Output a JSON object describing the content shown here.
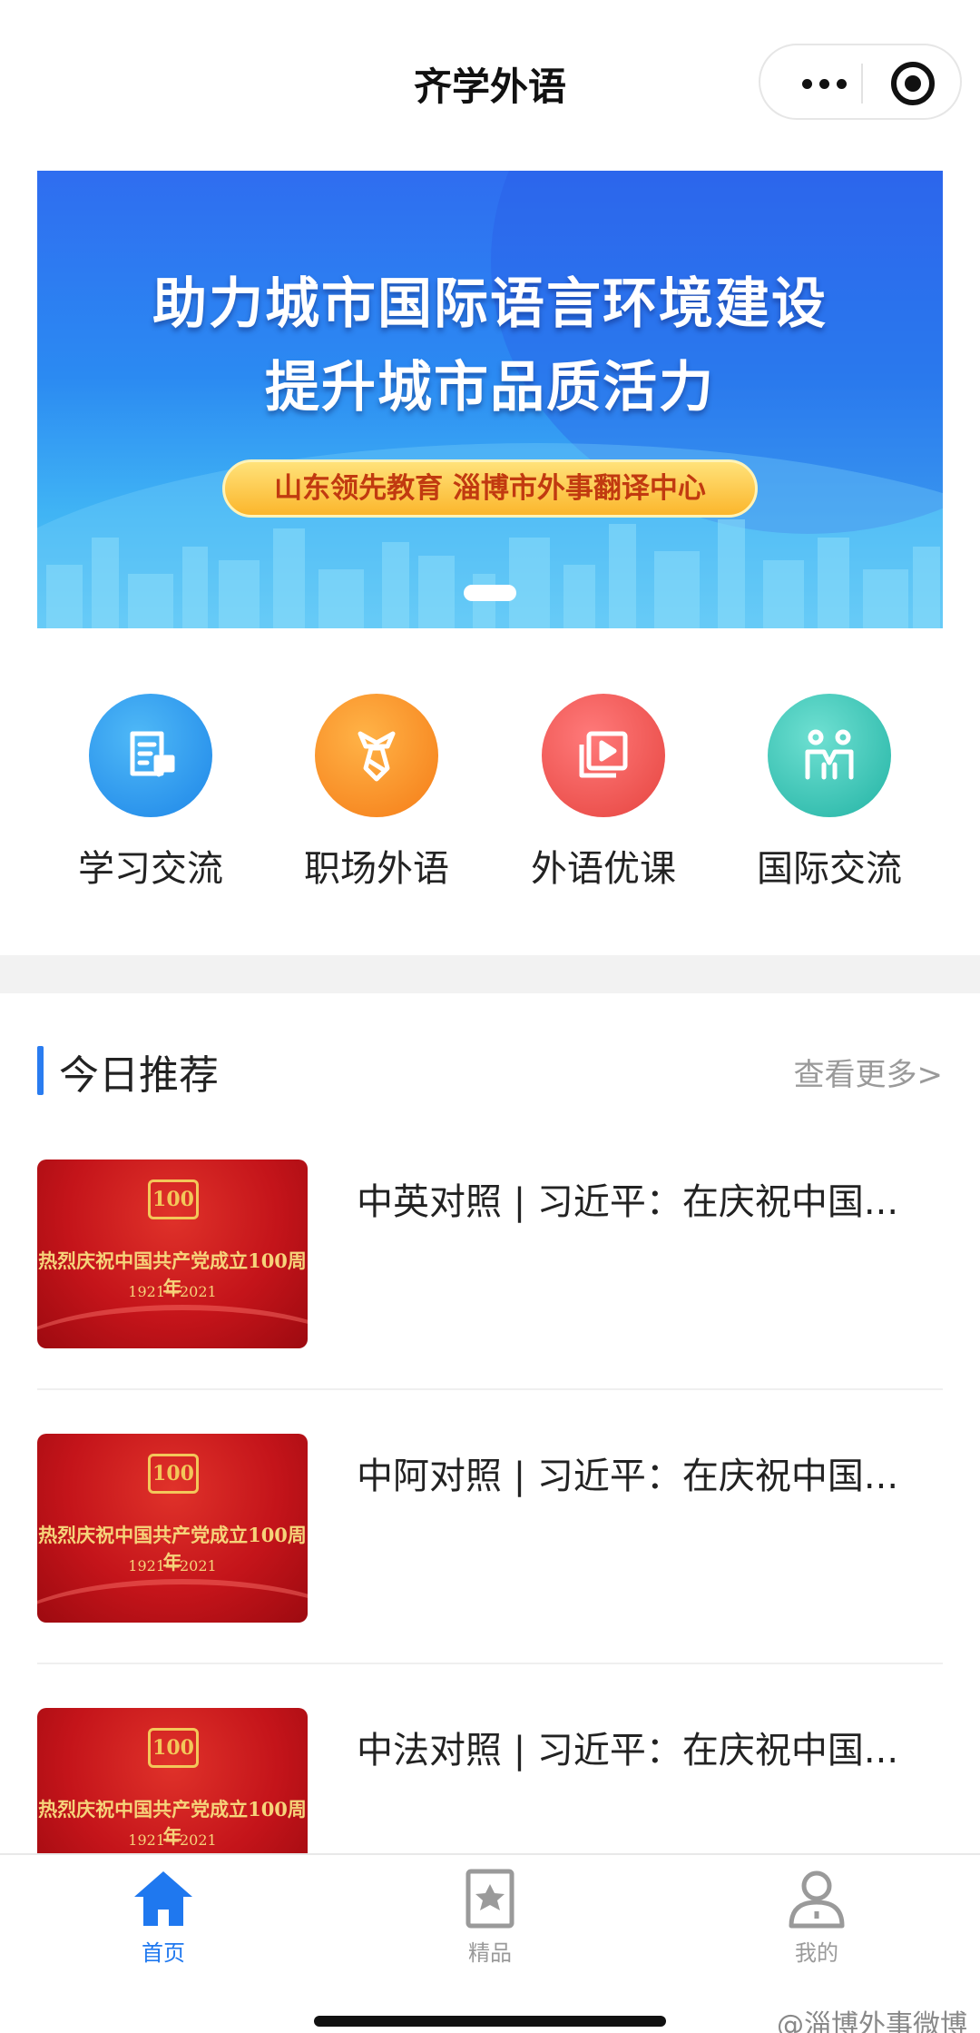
{
  "navbar": {
    "title": "齐学外语"
  },
  "banner": {
    "headline_1": "助力城市国际语言环境建设",
    "headline_2": "提升城市品质活力",
    "tagline": "山东领先教育  淄博市外事翻译中心"
  },
  "categories": [
    {
      "label": "学习交流",
      "icon": "document-chat-icon",
      "color": "#1e86e8"
    },
    {
      "label": "职场外语",
      "icon": "necktie-icon",
      "color": "#f57c17"
    },
    {
      "label": "外语优课",
      "icon": "video-play-icon",
      "color": "#e6443f"
    },
    {
      "label": "国际交流",
      "icon": "people-icon",
      "color": "#22b3a4"
    }
  ],
  "section": {
    "title": "今日推荐",
    "more": "查看更多>"
  },
  "articles": [
    {
      "title": "中英对照 | 习近平：在庆祝中国...",
      "thumb_title": "热烈庆祝中国共产党成立100周年",
      "thumb_years": "1921—2021",
      "thumb_emblem": "100"
    },
    {
      "title": "中阿对照 | 习近平：在庆祝中国...",
      "thumb_title": "热烈庆祝中国共产党成立100周年",
      "thumb_years": "1921—2021",
      "thumb_emblem": "100"
    },
    {
      "title": "中法对照 | 习近平：在庆祝中国...",
      "thumb_title": "热烈庆祝中国共产党成立100周年",
      "thumb_years": "1921—2021",
      "thumb_emblem": "100"
    }
  ],
  "tabbar": {
    "home": "首页",
    "featured": "精品",
    "mine": "我的",
    "active_color": "#1f78ef",
    "inactive_color": "#9a9a9a"
  },
  "watermark": "@淄博外事微博"
}
